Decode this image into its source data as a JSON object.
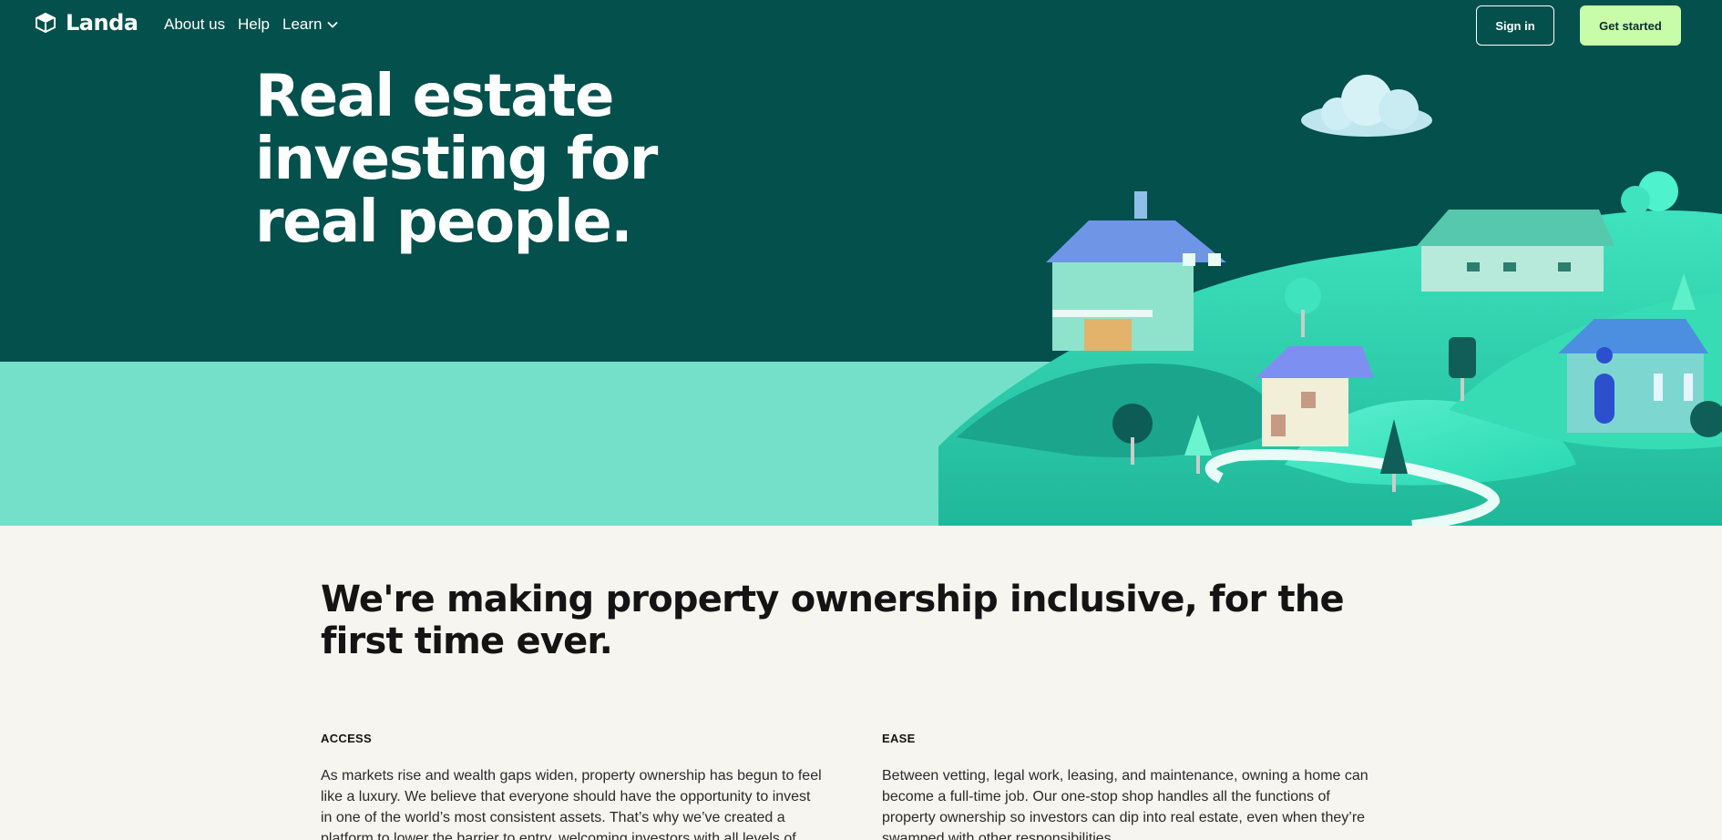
{
  "nav": {
    "logo": "Landa",
    "links": [
      "About us",
      "Help",
      "Learn"
    ],
    "sign_in": "Sign in",
    "get_started": "Get started"
  },
  "hero": {
    "title_lines": [
      "Real estate",
      "investing for",
      "real people."
    ]
  },
  "mission": {
    "heading": "We're making property ownership inclusive, for the first time ever."
  },
  "columns": [
    {
      "label": "ACCESS",
      "text": "As markets rise and wealth gaps widen, property ownership has begun to feel like a luxury. We believe that everyone should have the opportunity to invest in one of the world’s most consistent assets. That’s why we’ve created a platform to lower the barrier to entry, welcoming investors with all levels of capital and"
    },
    {
      "label": "EASE",
      "text": "Between vetting, legal work, leasing, and maintenance, owning a home can become a full-time job. Our one-stop shop handles all the functions of property ownership so investors can dip into real estate, even when they’re swamped with other responsibilities."
    }
  ],
  "colors": {
    "hero_bg": "#03504c",
    "hero_band": "#75e0c9",
    "accent_button": "#c8fca8",
    "page_bg": "#f7f5f0"
  },
  "icons": [
    "landa-logo-icon",
    "chevron-down-icon"
  ]
}
